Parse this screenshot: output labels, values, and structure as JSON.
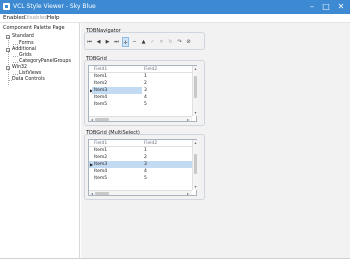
{
  "window": {
    "title": "VCL Style Viewer - Sky Blue",
    "min_glyph": "–",
    "max_glyph": "□",
    "close_glyph": "✕"
  },
  "menu": [
    "Enabled",
    "Disabled",
    "Help"
  ],
  "sidebar": {
    "title": "Component Palette Page",
    "tree": [
      {
        "label": "Standard",
        "expander": "−"
      },
      {
        "label": "Forms"
      },
      {
        "label": "Additional",
        "expander": "−"
      },
      {
        "label": "Grids"
      },
      {
        "label": "CategoryPanelGroups"
      },
      {
        "label": "Win32",
        "expander": "−"
      },
      {
        "label": "ListViews"
      },
      {
        "label": "Data Controls"
      }
    ]
  },
  "navigator": {
    "title": "TDBNavigator",
    "buttons": [
      {
        "glyph": "⏮",
        "icon": "first-record"
      },
      {
        "glyph": "◀",
        "icon": "prior-record"
      },
      {
        "glyph": "▶",
        "icon": "next-record"
      },
      {
        "glyph": "⏭",
        "icon": "last-record"
      },
      {
        "glyph": "✛",
        "icon": "insert-record"
      },
      {
        "glyph": "−",
        "icon": "delete-record"
      },
      {
        "glyph": "▲",
        "icon": "edit-record"
      },
      {
        "glyph": "✓",
        "icon": "post-edit"
      },
      {
        "glyph": "✕",
        "icon": "cancel-edit"
      },
      {
        "glyph": "↻",
        "icon": "refresh-data"
      },
      {
        "glyph": "↷",
        "icon": "apply-updates"
      },
      {
        "glyph": "⊘",
        "icon": "cancel-updates"
      }
    ]
  },
  "grid1": {
    "title": "TDBGrid",
    "columns": [
      "Field1",
      "Field2"
    ],
    "rows": [
      [
        "Item1",
        "1"
      ],
      [
        "Item2",
        "2"
      ],
      [
        "Item3",
        "3"
      ],
      [
        "Item4",
        "4"
      ],
      [
        "Item5",
        "5"
      ]
    ],
    "selected_index": 2,
    "row_indicator": "▶"
  },
  "grid2": {
    "title": "TDBGrid (MultiSelect)",
    "columns": [
      "Field1",
      "Field2"
    ],
    "rows": [
      [
        "Item1",
        "1"
      ],
      [
        "Item2",
        "2"
      ],
      [
        "Item3",
        "3"
      ],
      [
        "Item4",
        "4"
      ],
      [
        "Item5",
        "5"
      ]
    ],
    "selected_index": 2,
    "row_indicator": "▶"
  },
  "scroll_glyphs": {
    "up": "▴",
    "down": "▾",
    "left": "◂",
    "right": "▸"
  },
  "colors": {
    "titlebar": "#3d8ad3",
    "selection": "#c3dbf2",
    "panel_bg": "#f2f2f2"
  }
}
